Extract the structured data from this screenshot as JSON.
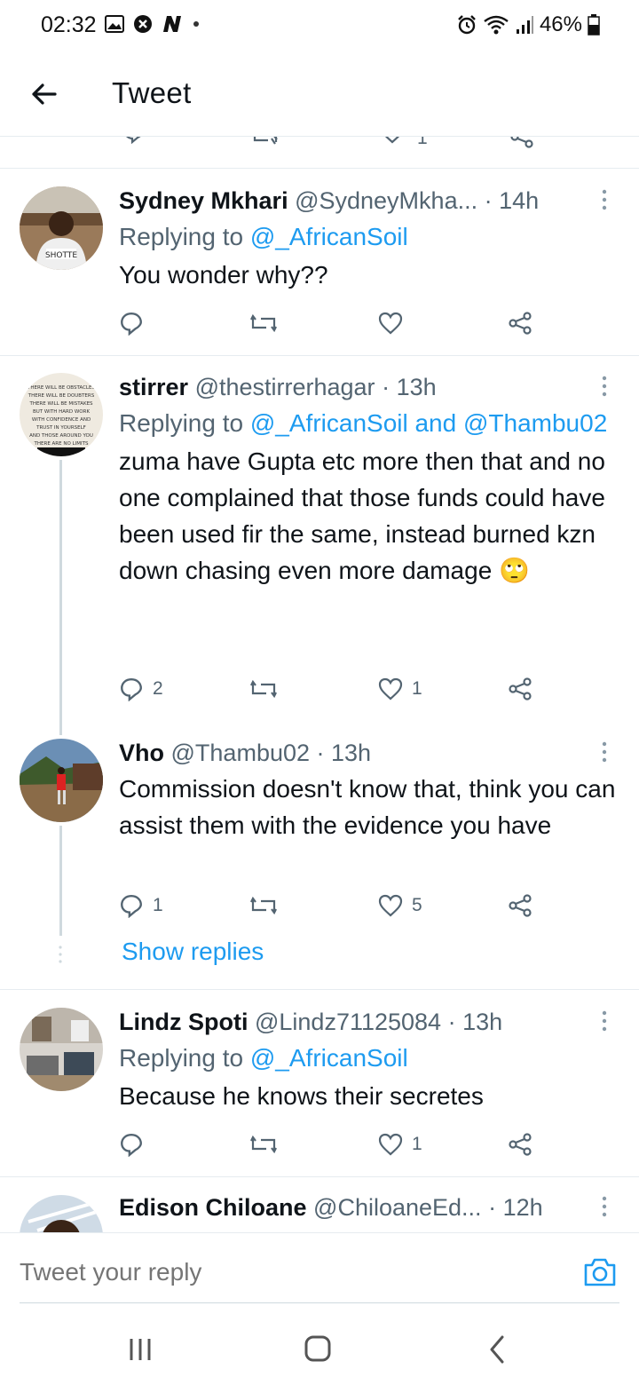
{
  "status_bar": {
    "time": "02:32",
    "battery": "46%",
    "icons": [
      "gallery-icon",
      "block-icon",
      "n-icon",
      "dot-icon",
      "alarm-icon",
      "wifi-icon",
      "signal-icon",
      "battery-icon"
    ]
  },
  "header": {
    "title": "Tweet",
    "back_icon": "arrow-left-icon"
  },
  "tweets": [
    {
      "name": "Sydney Mkhari",
      "handle": "@SydneyMkha...",
      "time": "· 14h",
      "replying_label": "Replying to",
      "mentions": "@_AfricanSoil",
      "text": "You wonder why??",
      "replies": "",
      "retweets": "",
      "likes": ""
    },
    {
      "name": "stirrer",
      "handle": "@thestirrerhagar",
      "time": "· 13h",
      "replying_label": "Replying to",
      "mentions": "@_AfricanSoil and @Thambu02",
      "text": "zuma have Gupta etc more then that and no one complained that those funds could have been used fir the same, instead burned kzn down chasing even more damage",
      "emoji": "🙄",
      "replies": "2",
      "retweets": "",
      "likes": "1"
    },
    {
      "name": "Vho",
      "handle": "@Thambu02",
      "time": "· 13h",
      "text": "Commission doesn't know that, think you can assist them with the evidence you have",
      "replies": "1",
      "retweets": "",
      "likes": "5"
    },
    {
      "name": "Lindz Spoti",
      "handle": "@Lindz71125084",
      "time": "· 13h",
      "replying_label": "Replying to",
      "mentions": "@_AfricanSoil",
      "text": "Because he knows their secretes",
      "replies": "",
      "retweets": "",
      "likes": "1"
    },
    {
      "name": "Edison Chiloane",
      "handle": "@ChiloaneEd...",
      "time": "· 12h"
    }
  ],
  "partial_tweet": {
    "likes": "1"
  },
  "show_replies": "Show replies",
  "reply_bar": {
    "placeholder": "Tweet your reply",
    "camera_icon": "camera-icon"
  },
  "nav_bar": {
    "buttons": [
      "recents-icon",
      "home-icon",
      "back-icon"
    ]
  },
  "colors": {
    "accent": "#1d9bf0",
    "text_secondary": "#536471",
    "divider": "#e6ecf0"
  }
}
